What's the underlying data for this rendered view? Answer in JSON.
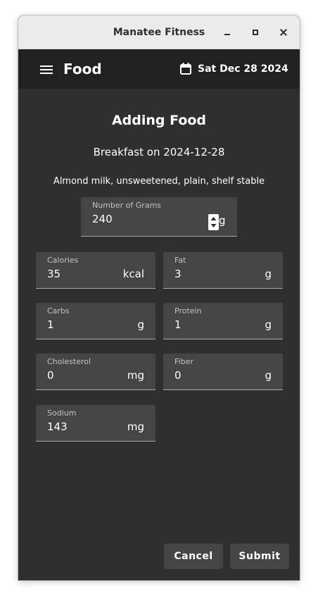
{
  "window": {
    "title": "Manatee Fitness"
  },
  "appbar": {
    "title": "Food",
    "date": "Sat Dec 28 2024"
  },
  "form": {
    "heading": "Adding Food",
    "subheading": "Breakfast on 2024-12-28",
    "food_name": "Almond milk, unsweetened, plain, shelf stable",
    "grams": {
      "label": "Number of Grams",
      "value": "240",
      "unit": "g"
    },
    "nutrients": {
      "calories": {
        "label": "Calories",
        "value": "35",
        "unit": "kcal"
      },
      "fat": {
        "label": "Fat",
        "value": "3",
        "unit": "g"
      },
      "carbs": {
        "label": "Carbs",
        "value": "1",
        "unit": "g"
      },
      "protein": {
        "label": "Protein",
        "value": "1",
        "unit": "g"
      },
      "cholesterol": {
        "label": "Cholesterol",
        "value": "0",
        "unit": "mg"
      },
      "fiber": {
        "label": "Fiber",
        "value": "0",
        "unit": "g"
      },
      "sodium": {
        "label": "Sodium",
        "value": "143",
        "unit": "mg"
      }
    }
  },
  "actions": {
    "cancel": "Cancel",
    "submit": "Submit"
  },
  "icons": {
    "menu": "hamburger-icon",
    "calendar": "calendar-icon",
    "minimize": "minimize-icon",
    "maximize": "maximize-icon",
    "close": "close-icon",
    "stepper": "stepper-icon"
  },
  "colors": {
    "appbar": "#212121",
    "background": "#2f2f2f",
    "field": "#454545",
    "button": "#454545",
    "titlebar": "#ebebe9"
  }
}
